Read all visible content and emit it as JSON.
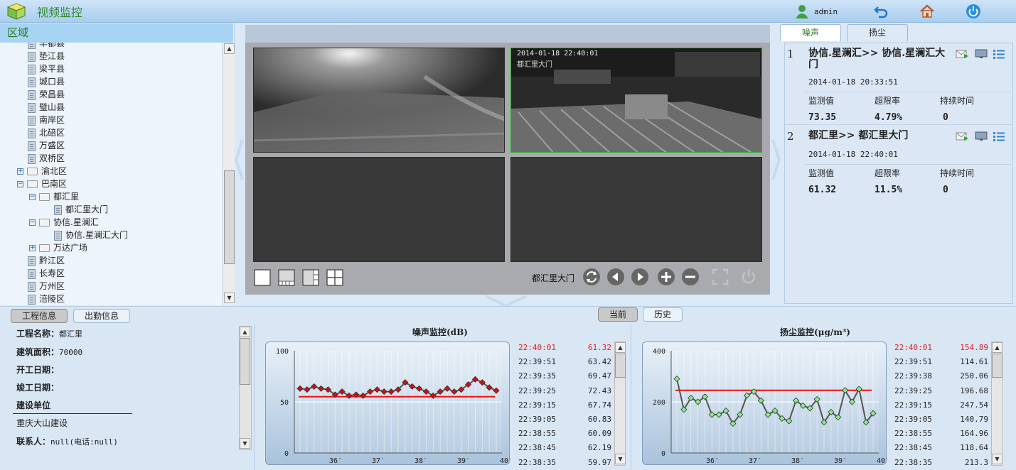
{
  "app": {
    "title": "视频监控",
    "user": "admin"
  },
  "tree": {
    "header": "区域",
    "items": [
      {
        "label": "丰都县",
        "level": 1,
        "kind": "doc"
      },
      {
        "label": "垫江县",
        "level": 1,
        "kind": "doc"
      },
      {
        "label": "梁平县",
        "level": 1,
        "kind": "doc"
      },
      {
        "label": "城口县",
        "level": 1,
        "kind": "doc"
      },
      {
        "label": "荣昌县",
        "level": 1,
        "kind": "doc"
      },
      {
        "label": "璧山县",
        "level": 1,
        "kind": "doc"
      },
      {
        "label": "南岸区",
        "level": 1,
        "kind": "doc"
      },
      {
        "label": "北碚区",
        "level": 1,
        "kind": "doc"
      },
      {
        "label": "万盛区",
        "level": 1,
        "kind": "doc"
      },
      {
        "label": "双桥区",
        "level": 1,
        "kind": "doc"
      },
      {
        "label": "渝北区",
        "level": 1,
        "kind": "folder",
        "state": "collapsed"
      },
      {
        "label": "巴南区",
        "level": 1,
        "kind": "folder",
        "state": "expanded"
      },
      {
        "label": "都汇里",
        "level": 2,
        "kind": "folder",
        "state": "expanded"
      },
      {
        "label": "都汇里大门",
        "level": 3,
        "kind": "doc"
      },
      {
        "label": "协信.星澜汇",
        "level": 2,
        "kind": "folder",
        "state": "expanded"
      },
      {
        "label": "协信.星澜汇大门",
        "level": 3,
        "kind": "doc"
      },
      {
        "label": "万达广场",
        "level": 2,
        "kind": "folder",
        "state": "collapsed"
      },
      {
        "label": "黔江区",
        "level": 1,
        "kind": "doc"
      },
      {
        "label": "长寿区",
        "level": 1,
        "kind": "doc"
      },
      {
        "label": "万州区",
        "level": 1,
        "kind": "doc"
      },
      {
        "label": "涪陵区",
        "level": 1,
        "kind": "doc"
      }
    ]
  },
  "video": {
    "current_camera": "都汇里大门",
    "overlay_text": "2014-01-18 22:40:01",
    "overlay_sub": "都汇里大门"
  },
  "alarm_tabs": [
    "噪声",
    "扬尘"
  ],
  "alarms": [
    {
      "index": "1",
      "title": "协信.星澜汇>> 协信.星澜汇大门",
      "time": "2014-01-18 20:33:51",
      "labels": [
        "监测值",
        "超限率",
        "持续时间"
      ],
      "values": [
        "73.35",
        "4.79%",
        "0"
      ]
    },
    {
      "index": "2",
      "title": "都汇里>> 都汇里大门",
      "time": "2014-01-18 22:40:01",
      "labels": [
        "监测值",
        "超限率",
        "持续时间"
      ],
      "values": [
        "61.32",
        "11.5%",
        "0"
      ]
    }
  ],
  "info_tabs": [
    "工程信息",
    "出勤信息"
  ],
  "info": {
    "name_label": "工程名称：",
    "name": "都汇里",
    "area_label": "建筑面积：",
    "area": "70000",
    "start_label": "开工日期：",
    "end_label": "竣工日期：",
    "builder_label": "建设单位",
    "builder": "重庆大山建设",
    "contact_label": "联系人：",
    "contact": "null(电话:null)"
  },
  "mode_tabs": [
    "当前",
    "历史"
  ],
  "chart_data": [
    {
      "type": "line",
      "title": "噪声监控(dB)",
      "ylim": [
        0,
        100
      ],
      "yticks": [
        "0",
        "50",
        "100"
      ],
      "xticks": [
        "36′",
        "37′",
        "38′",
        "39′",
        "40′"
      ],
      "threshold": 55,
      "values": [
        63,
        62,
        65,
        63,
        62,
        57,
        60,
        56,
        57,
        56,
        60,
        62,
        60,
        60,
        62,
        69,
        65,
        63,
        60,
        56,
        60,
        63,
        60,
        62,
        67,
        72,
        69,
        64,
        61
      ],
      "line_color": "#555555",
      "marker_color": "#cc1111",
      "threshold_color": "#ee1111",
      "grid": true
    },
    {
      "type": "line",
      "title": "扬尘监控(μg/m³)",
      "ylim": [
        0,
        400
      ],
      "yticks": [
        "0",
        "200",
        "400"
      ],
      "xticks": [
        "36′",
        "37′",
        "38′",
        "39′",
        "40′"
      ],
      "threshold": 245,
      "values": [
        290,
        170,
        215,
        200,
        220,
        150,
        150,
        165,
        115,
        150,
        225,
        240,
        205,
        150,
        165,
        135,
        125,
        205,
        185,
        175,
        210,
        120,
        160,
        140,
        245,
        200,
        250,
        120,
        155
      ],
      "line_color": "#555555",
      "marker_color": "#88ee88",
      "threshold_color": "#ee1111",
      "grid": true
    }
  ],
  "noise_table": [
    {
      "time": "22:40:01",
      "value": "61.32",
      "highlight": true
    },
    {
      "time": "22:39:51",
      "value": "63.42"
    },
    {
      "time": "22:39:35",
      "value": "69.47"
    },
    {
      "time": "22:39:25",
      "value": "72.43"
    },
    {
      "time": "22:39:15",
      "value": "67.74"
    },
    {
      "time": "22:39:05",
      "value": "60.83"
    },
    {
      "time": "22:38:55",
      "value": "60.09"
    },
    {
      "time": "22:38:45",
      "value": "62.19"
    },
    {
      "time": "22:38:35",
      "value": "59.97"
    }
  ],
  "dust_table": [
    {
      "time": "22:40:01",
      "value": "154.89",
      "highlight": true
    },
    {
      "time": "22:39:51",
      "value": "114.61"
    },
    {
      "time": "22:39:38",
      "value": "250.06"
    },
    {
      "time": "22:39:25",
      "value": "196.68"
    },
    {
      "time": "22:39:15",
      "value": "247.54"
    },
    {
      "time": "22:39:05",
      "value": "140.79"
    },
    {
      "time": "22:38:55",
      "value": "164.96"
    },
    {
      "time": "22:38:45",
      "value": "118.64"
    },
    {
      "time": "22:38:35",
      "value": "213.3"
    }
  ]
}
